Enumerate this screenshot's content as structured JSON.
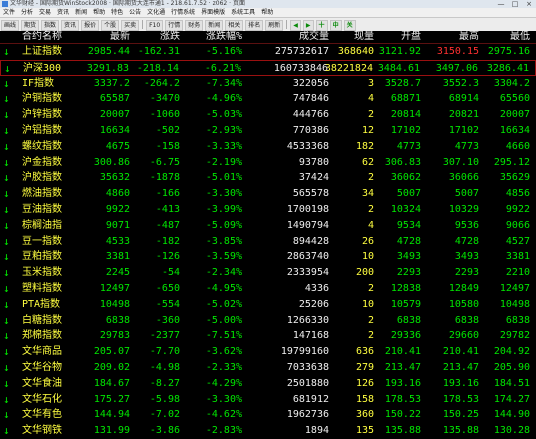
{
  "window": {
    "title": "文华财经 - 国际期货WinStock2008 · 国际期货大连市通1 - 218.61.7.52 · z062 · 页面",
    "min_label": "—",
    "max_label": "□",
    "close_label": "×"
  },
  "menu": [
    "文件",
    "分析",
    "交易",
    "资讯",
    "新闻",
    "帮助",
    "特色",
    "公告",
    "文化通",
    "行情系统",
    "界面模版",
    "系统工具",
    "帮助"
  ],
  "toolbar": [
    "画线",
    "期货",
    "指数",
    "资讯",
    "报价",
    "个股",
    "买卖",
    "F10",
    "行情",
    "财务",
    "新闻",
    "相关",
    "排名",
    "刷新",
    "◀",
    "▶",
    "十",
    "中",
    "关"
  ],
  "columns": {
    "name": "合约名称",
    "last": "最新",
    "change": "涨跌",
    "pct": "涨跌幅%",
    "volume": "成交量",
    "cur": "现量",
    "open": "开盘",
    "high": "最高",
    "low": "最低"
  },
  "rows": [
    {
      "name": "上证指数",
      "last": "2985.44",
      "change": "-162.31",
      "pct": "-5.16%",
      "volume": "275732617",
      "cur": "368640",
      "open": "3121.92",
      "high": "3150.15",
      "low": "2975.16"
    },
    {
      "name": "沪深300",
      "last": "3291.83",
      "change": "-218.14",
      "pct": "-6.21%",
      "volume": "160733846",
      "cur": "38221824",
      "open": "3484.61",
      "high": "3497.06",
      "low": "3286.41"
    },
    {
      "name": "IF指数",
      "last": "3337.2",
      "change": "-264.2",
      "pct": "-7.34%",
      "volume": "322056",
      "cur": "3",
      "open": "3528.7",
      "high": "3552.3",
      "low": "3304.2"
    },
    {
      "name": "沪铜指数",
      "last": "65587",
      "change": "-3470",
      "pct": "-4.96%",
      "volume": "747846",
      "cur": "4",
      "open": "68871",
      "high": "68914",
      "low": "65560"
    },
    {
      "name": "沪锌指数",
      "last": "20007",
      "change": "-1060",
      "pct": "-5.03%",
      "volume": "444766",
      "cur": "2",
      "open": "20814",
      "high": "20821",
      "low": "20007"
    },
    {
      "name": "沪铝指数",
      "last": "16634",
      "change": "-502",
      "pct": "-2.93%",
      "volume": "770386",
      "cur": "12",
      "open": "17102",
      "high": "17102",
      "low": "16634"
    },
    {
      "name": "螺纹指数",
      "last": "4675",
      "change": "-158",
      "pct": "-3.33%",
      "volume": "4533368",
      "cur": "182",
      "open": "4773",
      "high": "4773",
      "low": "4660"
    },
    {
      "name": "沪金指数",
      "last": "300.86",
      "change": "-6.75",
      "pct": "-2.19%",
      "volume": "93780",
      "cur": "62",
      "open": "306.83",
      "high": "307.10",
      "low": "295.12"
    },
    {
      "name": "沪胶指数",
      "last": "35632",
      "change": "-1878",
      "pct": "-5.01%",
      "volume": "37424",
      "cur": "2",
      "open": "36062",
      "high": "36066",
      "low": "35629"
    },
    {
      "name": "燃油指数",
      "last": "4860",
      "change": "-166",
      "pct": "-3.30%",
      "volume": "565578",
      "cur": "34",
      "open": "5007",
      "high": "5007",
      "low": "4856"
    },
    {
      "name": "豆油指数",
      "last": "9922",
      "change": "-413",
      "pct": "-3.99%",
      "volume": "1700198",
      "cur": "2",
      "open": "10324",
      "high": "10329",
      "low": "9922"
    },
    {
      "name": "棕榈油指",
      "last": "9071",
      "change": "-487",
      "pct": "-5.09%",
      "volume": "1490794",
      "cur": "4",
      "open": "9534",
      "high": "9536",
      "low": "9066"
    },
    {
      "name": "豆一指数",
      "last": "4533",
      "change": "-182",
      "pct": "-3.85%",
      "volume": "894428",
      "cur": "26",
      "open": "4728",
      "high": "4728",
      "low": "4527"
    },
    {
      "name": "豆粕指数",
      "last": "3381",
      "change": "-126",
      "pct": "-3.59%",
      "volume": "2863740",
      "cur": "10",
      "open": "3493",
      "high": "3493",
      "low": "3381"
    },
    {
      "name": "玉米指数",
      "last": "2245",
      "change": "-54",
      "pct": "-2.34%",
      "volume": "2333954",
      "cur": "200",
      "open": "2293",
      "high": "2293",
      "low": "2210"
    },
    {
      "name": "塑料指数",
      "last": "12497",
      "change": "-650",
      "pct": "-4.95%",
      "volume": "4336",
      "cur": "2",
      "open": "12838",
      "high": "12849",
      "low": "12497"
    },
    {
      "name": "PTA指数",
      "last": "10498",
      "change": "-554",
      "pct": "-5.02%",
      "volume": "25206",
      "cur": "10",
      "open": "10579",
      "high": "10580",
      "low": "10498"
    },
    {
      "name": "白糖指数",
      "last": "6838",
      "change": "-360",
      "pct": "-5.00%",
      "volume": "1266330",
      "cur": "2",
      "open": "6838",
      "high": "6838",
      "low": "6838"
    },
    {
      "name": "郑棉指数",
      "last": "29783",
      "change": "-2377",
      "pct": "-7.51%",
      "volume": "147168",
      "cur": "2",
      "open": "29336",
      "high": "29660",
      "low": "29782"
    },
    {
      "name": "文华商品",
      "last": "205.07",
      "change": "-7.70",
      "pct": "-3.62%",
      "volume": "19799160",
      "cur": "636",
      "open": "210.41",
      "high": "210.41",
      "low": "204.92"
    },
    {
      "name": "文华谷物",
      "last": "209.02",
      "change": "-4.98",
      "pct": "-2.33%",
      "volume": "7033638",
      "cur": "279",
      "open": "213.47",
      "high": "213.47",
      "low": "205.90"
    },
    {
      "name": "文华食油",
      "last": "184.67",
      "change": "-8.27",
      "pct": "-4.29%",
      "volume": "2501880",
      "cur": "126",
      "open": "193.16",
      "high": "193.16",
      "low": "184.51"
    },
    {
      "name": "文华石化",
      "last": "175.27",
      "change": "-5.98",
      "pct": "-3.30%",
      "volume": "681912",
      "cur": "158",
      "open": "178.53",
      "high": "178.53",
      "low": "174.27"
    },
    {
      "name": "文华有色",
      "last": "144.94",
      "change": "-7.02",
      "pct": "-4.62%",
      "volume": "1962736",
      "cur": "360",
      "open": "150.22",
      "high": "150.25",
      "low": "144.90"
    },
    {
      "name": "文华钢铁",
      "last": "131.99",
      "change": "-3.86",
      "pct": "-2.83%",
      "volume": "1894",
      "cur": "135",
      "open": "135.88",
      "high": "135.88",
      "low": "130.28"
    }
  ],
  "colors": {
    "name": "#ffff40",
    "down": "#00e600",
    "up": "#ff3030",
    "neutral": "#f0f0f0",
    "highlight_border": "#9a1010"
  }
}
